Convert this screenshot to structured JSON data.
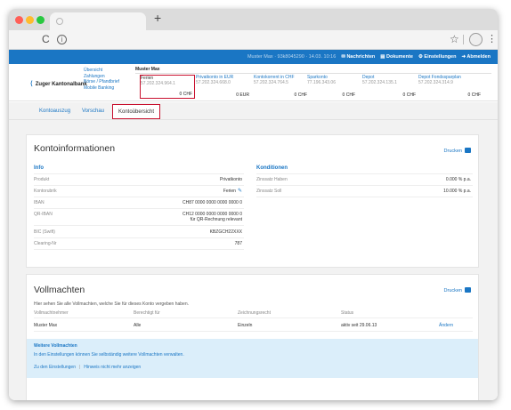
{
  "browser": {
    "new_tab_symbol": "+",
    "reload_symbol": "C",
    "info_symbol": "i",
    "star_symbol": "☆",
    "menu_symbol": "⋮"
  },
  "topbar": {
    "user": "Muster Max · 93k8045290 · 14.03. 10:16",
    "items": [
      {
        "icon": "mail-icon",
        "label": "Nachrichten"
      },
      {
        "icon": "document-icon",
        "label": "Dokumente"
      },
      {
        "icon": "gear-icon",
        "label": "Einstellungen"
      },
      {
        "icon": "logout-icon",
        "label": "Abmelden"
      }
    ]
  },
  "brand": {
    "name": "Zuger Kantonalbank",
    "mark": "⟨"
  },
  "nav": {
    "links": [
      "Übersicht",
      "Zahlungen",
      "Börse / Pfandbrief",
      "Mobile Banking"
    ]
  },
  "accounts": {
    "owner": "Muster Max",
    "items": [
      {
        "name": "Ferien",
        "number": "57.202.324.964.1",
        "balance": "0 CHF",
        "selected": true
      },
      {
        "name": "Privatkonto in EUR",
        "number": "57.202.324.668.0",
        "balance": "0 EUR",
        "selected": false
      },
      {
        "name": "Kontokorrent in CHF",
        "number": "57.202.324.764.5",
        "balance": "0 CHF",
        "selected": false
      },
      {
        "name": "Sparkonto",
        "number": "77.196.343.06",
        "balance": "0 CHF",
        "selected": false
      },
      {
        "name": "Depot",
        "number": "57.202.324.135.1",
        "balance": "0 CHF",
        "selected": false
      },
      {
        "name": "Depot Fondssparplan",
        "number": "57.202.324.314.9",
        "balance": "0 CHF",
        "selected": false
      }
    ]
  },
  "subtabs": {
    "items": [
      "Kontoauszug",
      "Vorschau",
      "Kontoübersicht"
    ],
    "active": 2
  },
  "kontoinfo": {
    "title": "Kontoinformationen",
    "print": "Drucken",
    "info_head": "Info",
    "konditionen_head": "Konditionen",
    "rows": [
      {
        "label": "Produkt",
        "value": "Privatkonto"
      },
      {
        "label": "Kontorubrik",
        "value": "Ferien"
      },
      {
        "label": "IBAN",
        "value": "CH87 0000 0000 0000 0000 0"
      },
      {
        "label": "QR-IBAN",
        "value": "CH12 0000 0000 0000 0000 0",
        "value2": "für QR-Rechnung relevant"
      },
      {
        "label": "BIC (Swift)",
        "value": "KBZGCH22XXX"
      },
      {
        "label": "Clearing-Nr",
        "value": "787"
      }
    ],
    "kond_rows": [
      {
        "label": "Zinssatz Haben",
        "value": "0.000 % p.a."
      },
      {
        "label": "Zinssatz Soll",
        "value": "10.000 % p.a."
      }
    ]
  },
  "vollmachten": {
    "title": "Vollmachten",
    "print": "Drucken",
    "intro": "Hier sehen Sie alle Vollmachten, welche Sie für dieses Konto vergeben haben.",
    "headers": [
      "Vollmachtnehmer",
      "Berechtigt für",
      "Zeichnungsrecht",
      "Status"
    ],
    "rows": [
      {
        "name": "Muster Max",
        "scope": "Alle",
        "sign": "Einzeln",
        "status": "aktiv seit 29.06.13",
        "action": "Ändern"
      }
    ],
    "notice": {
      "title": "Weitere Vollmachten",
      "desc": "In den Einstellungen können Sie selbständig weitere Vollmachten verwalten.",
      "link1": "Zu den Einstellungen",
      "separator": "|",
      "link2": "Hinweis nicht mehr anzeigen"
    }
  }
}
